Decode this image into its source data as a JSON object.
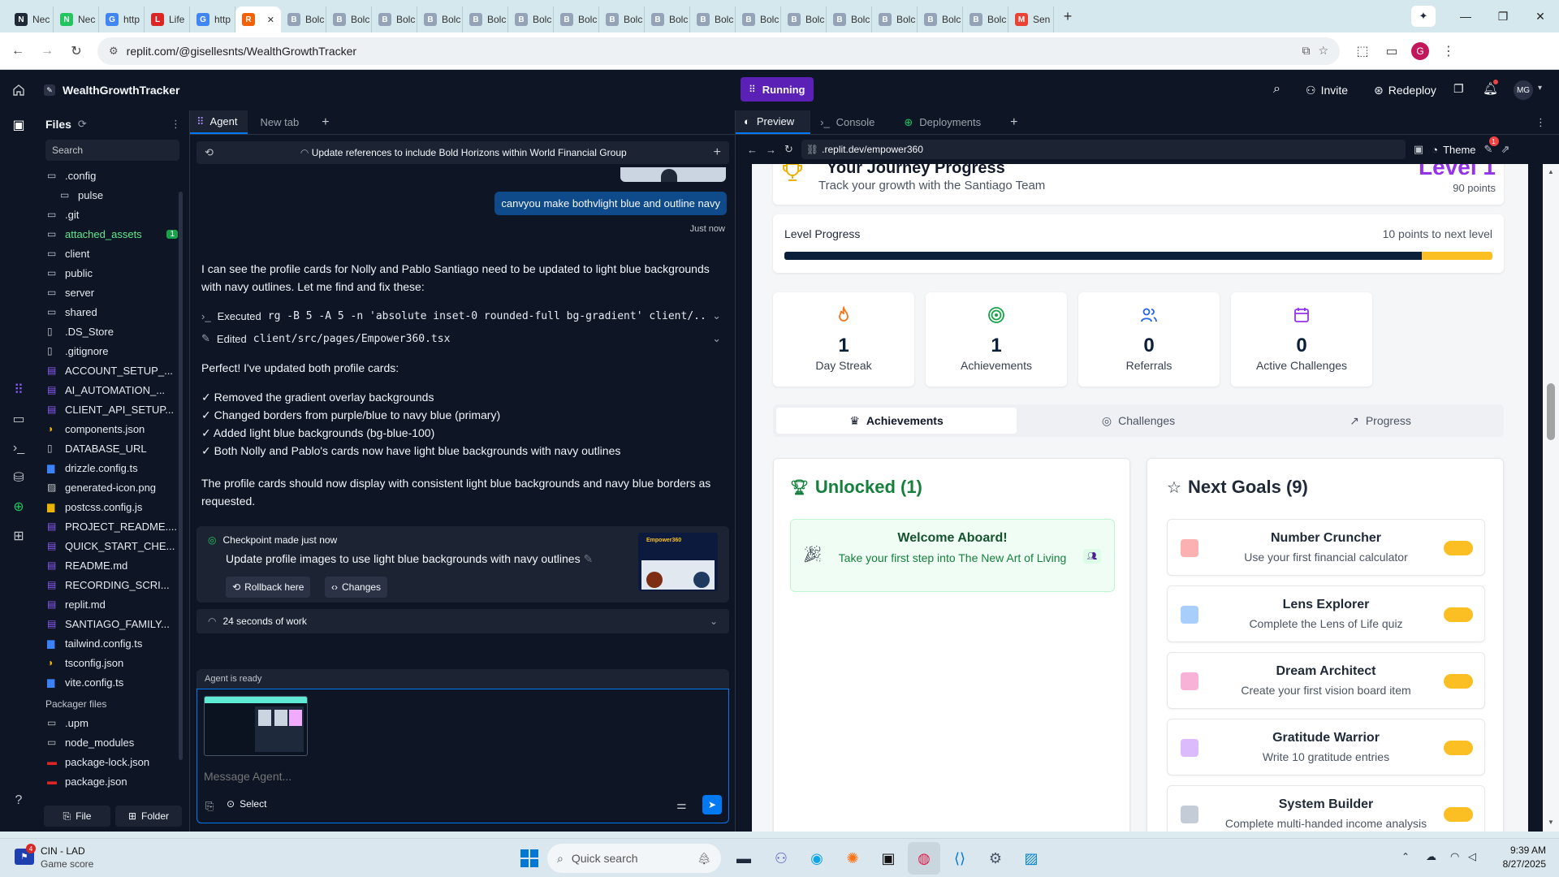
{
  "browser": {
    "tabs": [
      {
        "label": "Nec",
        "fav": "N",
        "color": "#1f2937"
      },
      {
        "label": "Nec",
        "fav": "N",
        "color": "#22c55e"
      },
      {
        "label": "http",
        "fav": "G",
        "color": "#4285f4"
      },
      {
        "label": "Life",
        "fav": "L",
        "color": "#dc2626"
      },
      {
        "label": "http",
        "fav": "G",
        "color": "#4285f4"
      },
      {
        "label": "",
        "fav": "R",
        "color": "#f26207",
        "active": true
      },
      {
        "label": "Bolc",
        "fav": "B",
        "color": "#94a3b8"
      },
      {
        "label": "Bolc",
        "fav": "B",
        "color": "#94a3b8"
      },
      {
        "label": "Bolc",
        "fav": "B",
        "color": "#94a3b8"
      },
      {
        "label": "Bolc",
        "fav": "B",
        "color": "#94a3b8"
      },
      {
        "label": "Bolc",
        "fav": "B",
        "color": "#94a3b8"
      },
      {
        "label": "Bolc",
        "fav": "B",
        "color": "#94a3b8"
      },
      {
        "label": "Bolc",
        "fav": "B",
        "color": "#94a3b8"
      },
      {
        "label": "Bolc",
        "fav": "B",
        "color": "#94a3b8"
      },
      {
        "label": "Bolc",
        "fav": "B",
        "color": "#94a3b8"
      },
      {
        "label": "Bolc",
        "fav": "B",
        "color": "#94a3b8"
      },
      {
        "label": "Bolc",
        "fav": "B",
        "color": "#94a3b8"
      },
      {
        "label": "Bolc",
        "fav": "B",
        "color": "#94a3b8"
      },
      {
        "label": "Bolc",
        "fav": "B",
        "color": "#94a3b8"
      },
      {
        "label": "Bolc",
        "fav": "B",
        "color": "#94a3b8"
      },
      {
        "label": "Bolc",
        "fav": "B",
        "color": "#94a3b8"
      },
      {
        "label": "Bolc",
        "fav": "B",
        "color": "#94a3b8"
      },
      {
        "label": "Sen",
        "fav": "M",
        "color": "#ea4335"
      }
    ],
    "url": "replit.com/@gisellesnts/WealthGrowthTracker"
  },
  "replit": {
    "project": "WealthGrowthTracker",
    "running": "Running",
    "invite": "Invite",
    "redeploy": "Redeploy",
    "avatar": "MG",
    "files_title": "Files",
    "search": "Search",
    "files": [
      {
        "name": ".config",
        "type": "folder"
      },
      {
        "name": "pulse",
        "type": "folder",
        "indent": true
      },
      {
        "name": ".git",
        "type": "folder"
      },
      {
        "name": "attached_assets",
        "type": "folder",
        "badge": "1",
        "green": true
      },
      {
        "name": "client",
        "type": "folder"
      },
      {
        "name": "public",
        "type": "folder"
      },
      {
        "name": "server",
        "type": "folder"
      },
      {
        "name": "shared",
        "type": "folder"
      },
      {
        "name": ".DS_Store",
        "type": "file"
      },
      {
        "name": ".gitignore",
        "type": "file"
      },
      {
        "name": "ACCOUNT_SETUP_...",
        "type": "md"
      },
      {
        "name": "AI_AUTOMATION_...",
        "type": "md"
      },
      {
        "name": "CLIENT_API_SETUP...",
        "type": "md"
      },
      {
        "name": "components.json",
        "type": "json"
      },
      {
        "name": "DATABASE_URL",
        "type": "file"
      },
      {
        "name": "drizzle.config.ts",
        "type": "ts"
      },
      {
        "name": "generated-icon.png",
        "type": "img"
      },
      {
        "name": "postcss.config.js",
        "type": "js"
      },
      {
        "name": "PROJECT_README....",
        "type": "md"
      },
      {
        "name": "QUICK_START_CHE...",
        "type": "md"
      },
      {
        "name": "README.md",
        "type": "md"
      },
      {
        "name": "RECORDING_SCRI...",
        "type": "md"
      },
      {
        "name": "replit.md",
        "type": "md"
      },
      {
        "name": "SANTIAGO_FAMILY...",
        "type": "md"
      },
      {
        "name": "tailwind.config.ts",
        "type": "ts"
      },
      {
        "name": "tsconfig.json",
        "type": "json"
      },
      {
        "name": "vite.config.ts",
        "type": "ts"
      }
    ],
    "packager_title": "Packager files",
    "packager": [
      {
        "name": ".upm",
        "type": "folder"
      },
      {
        "name": "node_modules",
        "type": "folder"
      },
      {
        "name": "package-lock.json",
        "type": "npm"
      },
      {
        "name": "package.json",
        "type": "npm"
      }
    ],
    "file_btn": "File",
    "folder_btn": "Folder"
  },
  "agent": {
    "tab_agent": "Agent",
    "tab_new": "New tab",
    "thread_title": "Update references to include Bold Horizons within World Financial Group",
    "user_msg": "canvyou make bothvlight blue and outline navy",
    "user_time": "Just now",
    "reply1": "I can see the profile cards for Nolly and Pablo Santiago need to be updated to light blue backgrounds with navy outlines. Let me find and fix these:",
    "exec_label": "Executed",
    "exec_cmd": "rg -B 5 -A 5 -n 'absolute inset-0 rounded-full bg-gradient' client/...",
    "edit_label": "Edited",
    "edit_file": "client/src/pages/Empower360.tsx",
    "perfect": "Perfect! I've updated both profile cards:",
    "checks": [
      "✓ Removed the gradient overlay backgrounds",
      "✓ Changed borders from purple/blue to navy blue (primary)",
      "✓ Added light blue backgrounds (bg-blue-100)",
      "✓ Both Nolly and Pablo's cards now have light blue backgrounds with navy outlines"
    ],
    "summary": "The profile cards should now display with consistent light blue backgrounds and navy blue borders as requested.",
    "checkpoint_head": "Checkpoint made just now",
    "checkpoint_text": "Update profile images to use light blue backgrounds with navy outlines",
    "rollback": "Rollback here",
    "changes": "Changes",
    "work": "24 seconds of work",
    "ready": "Agent is ready",
    "placeholder": "Message Agent...",
    "select": "Select",
    "thumb_label": "Empower360"
  },
  "preview": {
    "tab_preview": "Preview",
    "tab_console": "Console",
    "tab_deployments": "Deployments",
    "url": ".replit.dev/empower360",
    "theme": "Theme",
    "theme_badge": "1",
    "header_title": "Your Journey Progress",
    "header_sub": "Track your growth with the Santiago Team",
    "level": "Level 1",
    "points": "90 points",
    "progress_label": "Level Progress",
    "progress_next": "10 points to next level",
    "progress_value": 0.9,
    "stats": [
      {
        "value": "1",
        "label": "Day Streak",
        "icon": "flame-icon",
        "color": "#f97316"
      },
      {
        "value": "1",
        "label": "Achievements",
        "icon": "target-icon",
        "color": "#16a34a"
      },
      {
        "value": "0",
        "label": "Referrals",
        "icon": "users-icon",
        "color": "#2563eb"
      },
      {
        "value": "0",
        "label": "Active Challenges",
        "icon": "calendar-icon",
        "color": "#9333ea"
      }
    ],
    "tabs": [
      "Achievements",
      "Challenges",
      "Progress"
    ],
    "unlocked_title": "Unlocked (1)",
    "welcome_title": "Welcome Aboard!",
    "welcome_desc": "Take your first step into The New Art of Living",
    "next_title": "Next Goals (9)",
    "goals": [
      {
        "title": "Number Cruncher",
        "desc": "Use your first financial calculator",
        "color": "#f87171"
      },
      {
        "title": "Lens Explorer",
        "desc": "Complete the Lens of Life quiz",
        "color": "#60a5fa"
      },
      {
        "title": "Dream Architect",
        "desc": "Create your first vision board item",
        "color": "#f472b6"
      },
      {
        "title": "Gratitude Warrior",
        "desc": "Write 10 gratitude entries",
        "color": "#c084fc"
      },
      {
        "title": "System Builder",
        "desc": "Complete multi-handed income analysis",
        "color": "#94a3b8"
      }
    ]
  },
  "taskbar": {
    "game_title": "CIN - LAD",
    "game_sub": "Game score",
    "game_badge": "4",
    "search": "Quick search",
    "time": "9:39 AM",
    "date": "8/27/2025"
  }
}
